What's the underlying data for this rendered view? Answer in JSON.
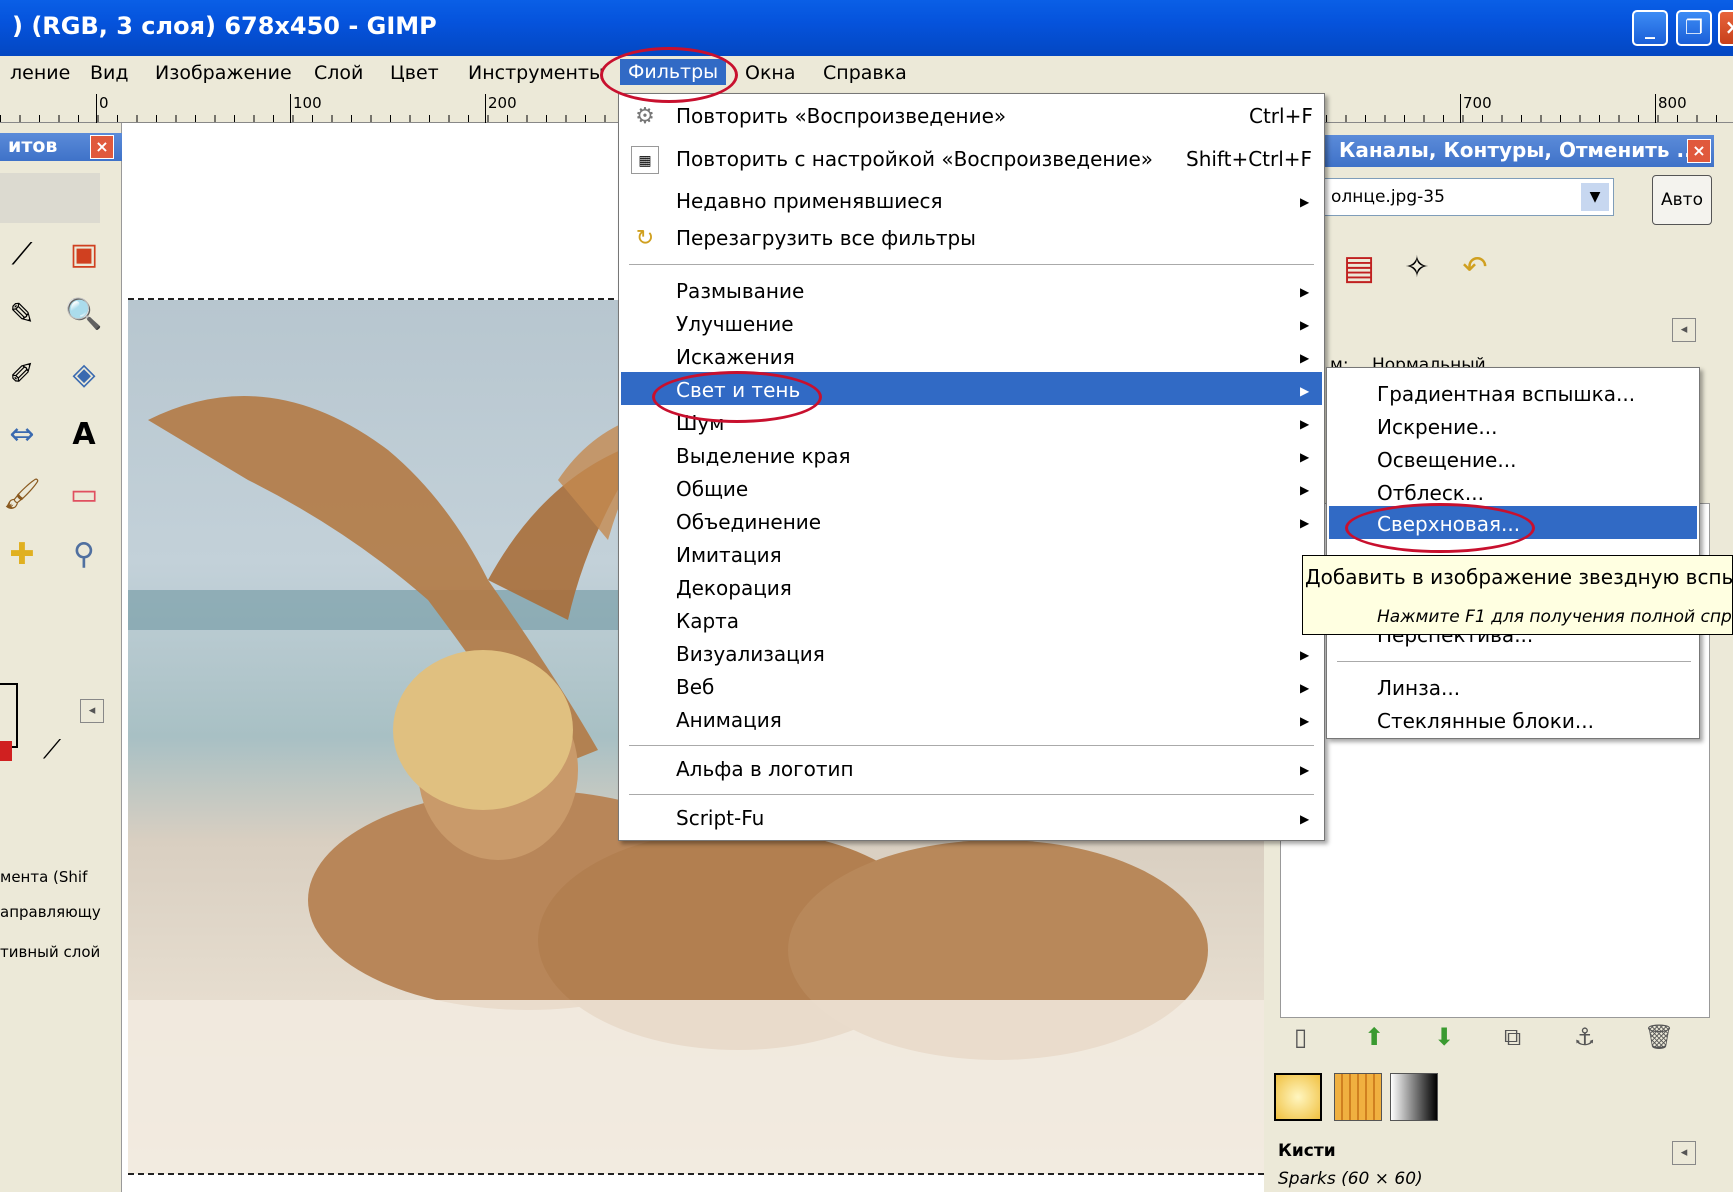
{
  "window": {
    "title": ") (RGB, 3 слоя) 678x450 - GIMP",
    "min": "_",
    "max": "❐",
    "close": "×"
  },
  "menubar": {
    "items": [
      "ление",
      "Вид",
      "Изображение",
      "Слой",
      "Цвет",
      "Инструменты",
      "Фильтры",
      "Окна",
      "Справка"
    ]
  },
  "ruler": {
    "labels": [
      "0",
      "100",
      "200",
      "700",
      "800"
    ]
  },
  "toolbox": {
    "header": "итов",
    "close": "×",
    "texts": [
      "мента  (Shif",
      "аправляющу",
      "тивный слой"
    ]
  },
  "dock": {
    "header": "Каналы, Контуры, Отменить ...",
    "close": "×",
    "image_select": "олнце.jpg-35",
    "auto_button": "Авто",
    "mode_label": "м:",
    "mode_value": "Нормальный",
    "brushes_title": "Кисти",
    "brush_name": "Sparks (60 × 60)"
  },
  "filters_menu": {
    "items": [
      {
        "label": "Повторить «Воспроизведение»",
        "shortcut": "Ctrl+F"
      },
      {
        "label": "Повторить с настройкой «Воспроизведение»",
        "shortcut": "Shift+Ctrl+F"
      },
      {
        "label": "Недавно применявшиеся"
      },
      {
        "label": "Перезагрузить все фильтры"
      },
      {
        "label": "Размывание"
      },
      {
        "label": "Улучшение"
      },
      {
        "label": "Искажения"
      },
      {
        "label": "Свет и тень"
      },
      {
        "label": "Шум"
      },
      {
        "label": "Выделение края"
      },
      {
        "label": "Общие"
      },
      {
        "label": "Объединение"
      },
      {
        "label": "Имитация"
      },
      {
        "label": "Декорация"
      },
      {
        "label": "Карта"
      },
      {
        "label": "Визуализация"
      },
      {
        "label": "Веб"
      },
      {
        "label": "Анимация"
      },
      {
        "label": "Альфа в логотип"
      },
      {
        "label": "Script-Fu"
      }
    ]
  },
  "submenu": {
    "items": [
      "Градиентная вспышка...",
      "Искрение...",
      "Освещение...",
      "Отблеск...",
      "Сверхновая...",
      "Перспектива...",
      "Линза...",
      "Стеклянные блоки..."
    ]
  },
  "tooltip": {
    "text": "Добавить в изображение звездную вспыш",
    "hint": "Нажмите F1 для получения полной спра"
  },
  "colors": {
    "titlebar": "#0553dc",
    "selection": "#316ac5",
    "annotation": "#c8102e",
    "tooltip_bg": "#ffffe1"
  }
}
